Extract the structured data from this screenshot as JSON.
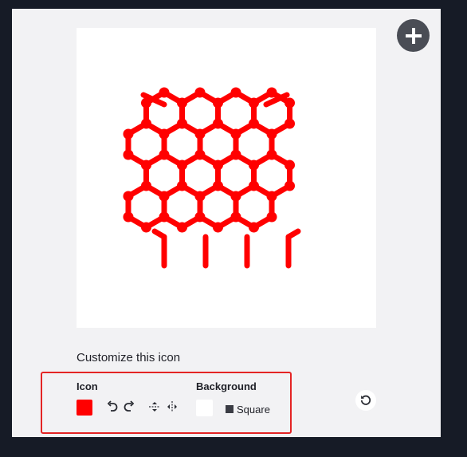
{
  "customize": {
    "title": "Customize this icon",
    "icon_label": "Icon",
    "background_label": "Background",
    "shape_label": "Square"
  },
  "icons": {
    "add": "plus-icon",
    "rotate_left": "rotate-left-icon",
    "rotate_right": "rotate-right-icon",
    "flip_vertical": "flip-vertical-icon",
    "flip_horizontal": "flip-horizontal-icon",
    "reset": "reset-icon",
    "preview": "hexagon-lattice-icon"
  },
  "colors": {
    "icon_color": "#ff0000",
    "background_color": "#ffffff",
    "highlight": "#e42424"
  }
}
